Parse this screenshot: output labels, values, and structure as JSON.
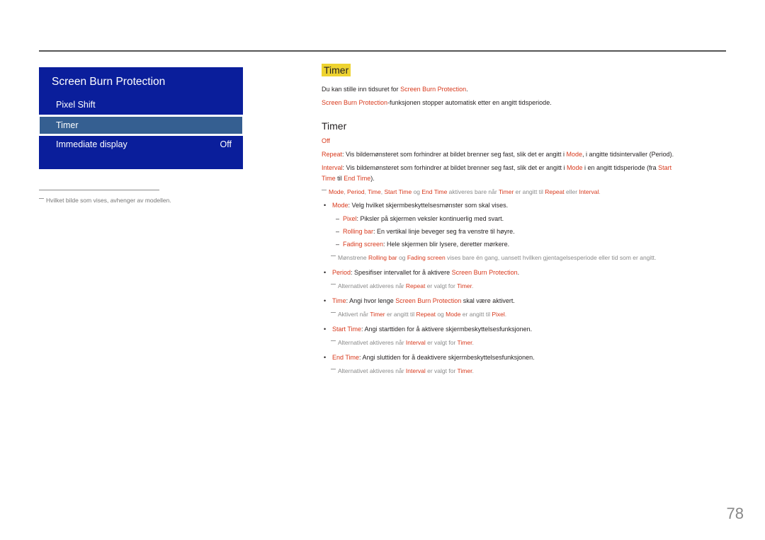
{
  "menu": {
    "title": "Screen Burn Protection",
    "items": [
      {
        "label": "Pixel Shift"
      },
      {
        "label": "Timer",
        "selected": true
      },
      {
        "label": "Immediate display",
        "value": "Off"
      }
    ]
  },
  "footnote": "Hvilket bilde som vises, avhenger av modellen.",
  "section": {
    "highlight_title": "Timer",
    "intro1_a": "Du kan stille inn tidsuret for ",
    "intro1_b": "Screen Burn Protection",
    "intro1_c": ".",
    "intro2_a": "Screen Burn Protection",
    "intro2_b": "-funksjonen stopper automatisk etter en angitt tidsperiode.",
    "subtitle": "Timer",
    "off": "Off",
    "repeat_a": "Repeat",
    "repeat_b": ": Vis bildemønsteret som forhindrer at bildet brenner seg fast, slik det er angitt i ",
    "repeat_c": "Mode",
    "repeat_d": ", i angitte tidsintervaller (Period).",
    "interval_a": "Interval",
    "interval_b": ": Vis bildemønsteret som forhindrer at bildet brenner seg fast, slik det er angitt i ",
    "interval_c": "Mode",
    "interval_d": " i en angitt tidsperiode (fra ",
    "interval_e": "Start",
    "interval2_a": "Time",
    "interval2_b": " til ",
    "interval2_c": "End Time",
    "interval2_d": ").",
    "note1": [
      "Mode",
      ", ",
      "Period",
      ", ",
      "Time",
      ", ",
      "Start Time",
      " og ",
      "End Time",
      " aktiveres bare når ",
      "Timer",
      " er angitt til ",
      "Repeat",
      " eller ",
      "Interval",
      "."
    ],
    "mode_a": "Mode",
    "mode_b": ": Velg hvilket skjermbeskyttelsesmønster som skal vises.",
    "pixel_a": "Pixel",
    "pixel_b": ": Piksler på skjermen veksler kontinuerlig med svart.",
    "rolling_a": "Rolling bar",
    "rolling_b": ": En vertikal linje beveger seg fra venstre til høyre.",
    "fading_a": "Fading screen",
    "fading_b": ": Hele skjermen blir lysere, deretter mørkere.",
    "note2": [
      "Mønstrene ",
      "Rolling bar",
      " og ",
      "Fading screen",
      " vises bare én gang, uansett hvilken gjentagelsesperiode eller tid som er angitt."
    ],
    "period_a": "Period",
    "period_b": ": Spesifiser intervallet for å aktivere ",
    "period_c": "Screen Burn Protection",
    "period_d": ".",
    "note3": [
      "Alternativet aktiveres når ",
      "Repeat",
      " er valgt for ",
      "Timer",
      "."
    ],
    "time_a": "Time",
    "time_b": ": Angi hvor lenge ",
    "time_c": "Screen Burn Protection",
    "time_d": " skal være aktivert.",
    "note4": [
      "Aktivert når ",
      "Timer",
      " er angitt til ",
      "Repeat",
      " og ",
      "Mode",
      " er angitt til ",
      "Pixel",
      "."
    ],
    "start_a": "Start Time",
    "start_b": ": Angi starttiden for å aktivere skjermbeskyttelsesfunksjonen.",
    "note5": [
      "Alternativet aktiveres når ",
      "Interval",
      " er valgt for ",
      "Timer",
      "."
    ],
    "end_a": "End Time",
    "end_b": ": Angi sluttiden for å deaktivere skjermbeskyttelsesfunksjonen.",
    "note6": [
      "Alternativet aktiveres når ",
      "Interval",
      " er valgt for ",
      "Timer",
      "."
    ]
  },
  "page_number": "78",
  "colors": {
    "menu_bg": "#0a1e9b",
    "menu_selected": "#355f91",
    "accent_red": "#d8391c",
    "highlight_yellow": "#eed330"
  }
}
